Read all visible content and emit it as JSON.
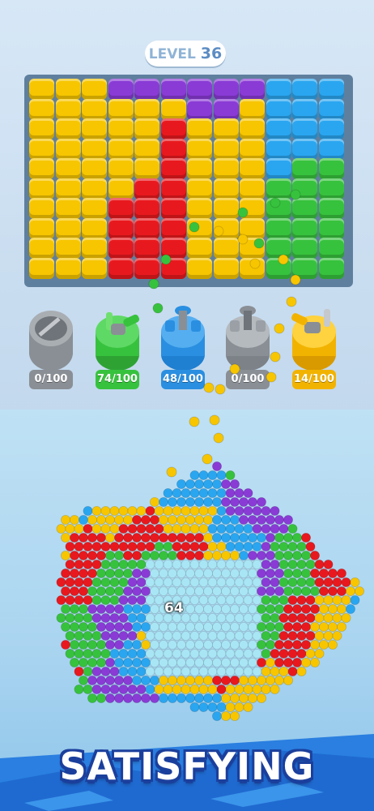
{
  "level": {
    "word": "LEVEL",
    "number": "36"
  },
  "palette": {
    "yellow": "#f7c600",
    "purple": "#8a3bd6",
    "blue": "#2aa6f0",
    "red": "#e8191e",
    "green": "#37c23d",
    "light_blue": "#a9e6f5",
    "gray": "#9aa0a6"
  },
  "cannons": [
    {
      "label": "0/100",
      "color": "#8a8f95",
      "icon": "empty-cannon-slot-icon",
      "state": "empty"
    },
    {
      "label": "74/100",
      "color": "#37c23d",
      "icon": "green-cannon-icon",
      "state": "firing"
    },
    {
      "label": "48/100",
      "color": "#2a8fe0",
      "icon": "blue-cannon-icon",
      "state": "idle"
    },
    {
      "label": "0/100",
      "color": "#8a8f95",
      "icon": "gray-cannon-icon",
      "state": "idle"
    },
    {
      "label": "14/100",
      "color": "#f2b300",
      "icon": "yellow-cannon-icon",
      "state": "firing"
    }
  ],
  "shape_counter": "64",
  "banner_text": "SATISFYING"
}
